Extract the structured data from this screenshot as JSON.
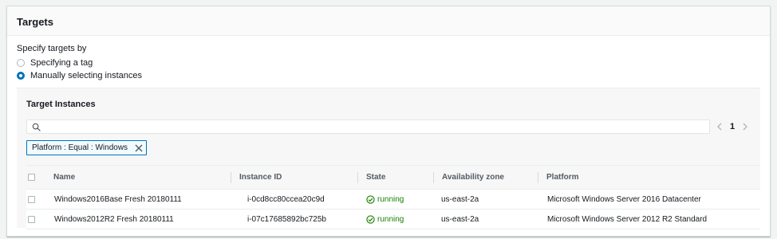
{
  "panel": {
    "title": "Targets",
    "specify_label": "Specify targets by",
    "options": [
      {
        "label": "Specifying a tag",
        "selected": false
      },
      {
        "label": "Manually selecting instances",
        "selected": true
      }
    ]
  },
  "target_instances": {
    "title": "Target Instances",
    "search": {
      "value": "",
      "placeholder": ""
    },
    "pagination": {
      "current_page": "1"
    },
    "filter_token": "Platform : Equal : Windows",
    "columns": [
      "Name",
      "Instance ID",
      "State",
      "Availability zone",
      "Platform"
    ],
    "rows": [
      {
        "name": "Windows2016Base Fresh 20180111",
        "instance_id": "i-0cd8cc80ccea20c9d",
        "state": "running",
        "zone": "us-east-2a",
        "platform": "Microsoft Windows Server 2016 Datacenter"
      },
      {
        "name": "Windows2012R2 Fresh 20180111",
        "instance_id": "i-07c17685892bc725b",
        "state": "running",
        "zone": "us-east-2a",
        "platform": "Microsoft Windows Server 2012 R2 Standard"
      }
    ]
  },
  "colors": {
    "accent": "#0073bb",
    "running": "#1d8102"
  },
  "icons": [
    "search-icon",
    "chevron-left-icon",
    "chevron-right-icon",
    "close-icon",
    "check-circle-icon"
  ]
}
